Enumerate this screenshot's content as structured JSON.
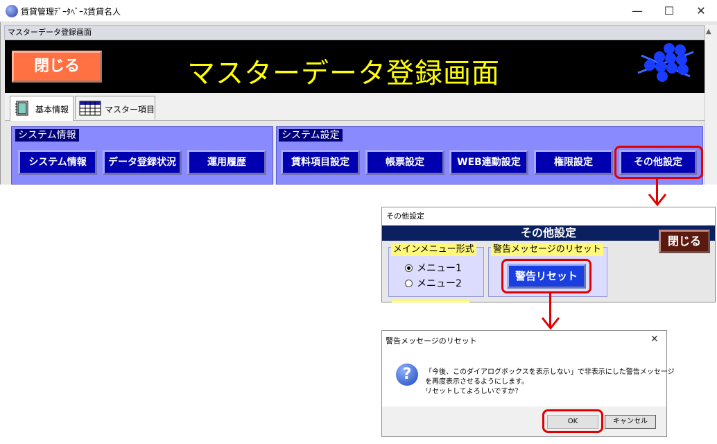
{
  "window": {
    "title": "賃貸管理ﾃﾞｰﾀﾍﾞｰｽ賃貸名人",
    "minimize": "—",
    "maximize": "☐",
    "close": "✕"
  },
  "mdi": {
    "title": "マスターデータ登録画面",
    "close_button": "閉じる",
    "header_title": "マスターデータ登録画面"
  },
  "tabs": [
    {
      "label": "基本情報",
      "icon": "notebook-icon",
      "active": true
    },
    {
      "label": "マスター項目",
      "icon": "table-icon",
      "active": false
    }
  ],
  "groups": {
    "system_info": {
      "label": "システム情報",
      "buttons": [
        "システム情報",
        "データ登録状況",
        "運用履歴"
      ]
    },
    "system_settings": {
      "label": "システム設定",
      "buttons": [
        "賃料項目設定",
        "帳票設定",
        "WEB連動設定",
        "権限設定",
        "その他設定"
      ]
    }
  },
  "sub_window": {
    "title": "その他設定",
    "header": "その他設定",
    "close_button": "閉じる",
    "menu_group": {
      "label": "メインメニュー形式",
      "options": [
        "メニュー1",
        "メニュー2"
      ],
      "selected": "メニュー1"
    },
    "reset_group": {
      "label": "警告メッセージのリセット",
      "button": "警告リセット"
    }
  },
  "dialog": {
    "title": "警告メッセージのリセット",
    "close": "✕",
    "message_line1": "「今後、このダイアログボックスを表示しない」で非表示にした警告メッセージ",
    "message_line2": "を再度表示させるようにします。",
    "message_line3": "リセットしてよろしいですか？",
    "ok": "OK",
    "cancel": "キャンセル"
  },
  "colors": {
    "highlight": "#e00000",
    "header_bg": "#000000",
    "header_title": "#ffff00",
    "group_bg": "#8a8aff",
    "button_blue": "#0000b0"
  }
}
